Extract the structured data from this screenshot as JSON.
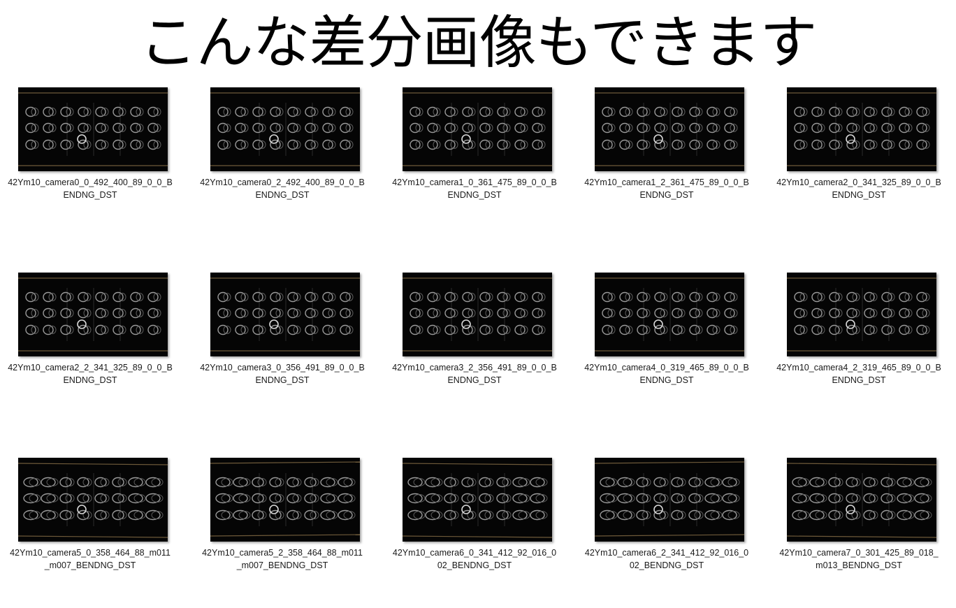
{
  "title": "こんな差分画像もできます",
  "colors": {
    "thumb_bg": "#050505",
    "ring": "#9a9a9a",
    "ring_bright": "#d8d8d8",
    "rail": "#6e5a3a"
  },
  "files": [
    {
      "line1": "42Ym10_camera0_0_492_400_89_0_0_B",
      "line2": "ENDNG_DST",
      "highlight_col": 3,
      "highlight_row": 1
    },
    {
      "line1": "42Ym10_camera0_2_492_400_89_0_0_B",
      "line2": "ENDNG_DST",
      "highlight_col": 3,
      "highlight_row": 1
    },
    {
      "line1": "42Ym10_camera1_0_361_475_89_0_0_B",
      "line2": "ENDNG_DST",
      "highlight_col": 3,
      "highlight_row": 1
    },
    {
      "line1": "42Ym10_camera1_2_361_475_89_0_0_B",
      "line2": "ENDNG_DST",
      "highlight_col": 3,
      "highlight_row": 1
    },
    {
      "line1": "42Ym10_camera2_0_341_325_89_0_0_B",
      "line2": "ENDNG_DST",
      "highlight_col": 3,
      "highlight_row": 1
    },
    {
      "line1": "42Ym10_camera2_2_341_325_89_0_0_B",
      "line2": "ENDNG_DST",
      "highlight_col": 3,
      "highlight_row": 1
    },
    {
      "line1": "42Ym10_camera3_0_356_491_89_0_0_B",
      "line2": "ENDNG_DST",
      "highlight_col": 3,
      "highlight_row": 1
    },
    {
      "line1": "42Ym10_camera3_2_356_491_89_0_0_B",
      "line2": "ENDNG_DST",
      "highlight_col": 3,
      "highlight_row": 1
    },
    {
      "line1": "42Ym10_camera4_0_319_465_89_0_0_B",
      "line2": "ENDNG_DST",
      "highlight_col": 3,
      "highlight_row": 1
    },
    {
      "line1": "42Ym10_camera4_2_319_465_89_0_0_B",
      "line2": "ENDNG_DST",
      "highlight_col": 3,
      "highlight_row": 1
    },
    {
      "line1": "42Ym10_camera5_0_358_464_88_m011",
      "line2": "_m007_BENDNG_DST",
      "highlight_col": 3,
      "highlight_row": 1
    },
    {
      "line1": "42Ym10_camera5_2_358_464_88_m011",
      "line2": "_m007_BENDNG_DST",
      "highlight_col": 3,
      "highlight_row": 1
    },
    {
      "line1": "42Ym10_camera6_0_341_412_92_016_0",
      "line2": "02_BENDNG_DST",
      "highlight_col": 3,
      "highlight_row": 1
    },
    {
      "line1": "42Ym10_camera6_2_341_412_92_016_0",
      "line2": "02_BENDNG_DST",
      "highlight_col": 3,
      "highlight_row": 1
    },
    {
      "line1": "42Ym10_camera7_0_301_425_89_018_",
      "line2": "m013_BENDNG_DST",
      "highlight_col": 3,
      "highlight_row": 1
    }
  ]
}
